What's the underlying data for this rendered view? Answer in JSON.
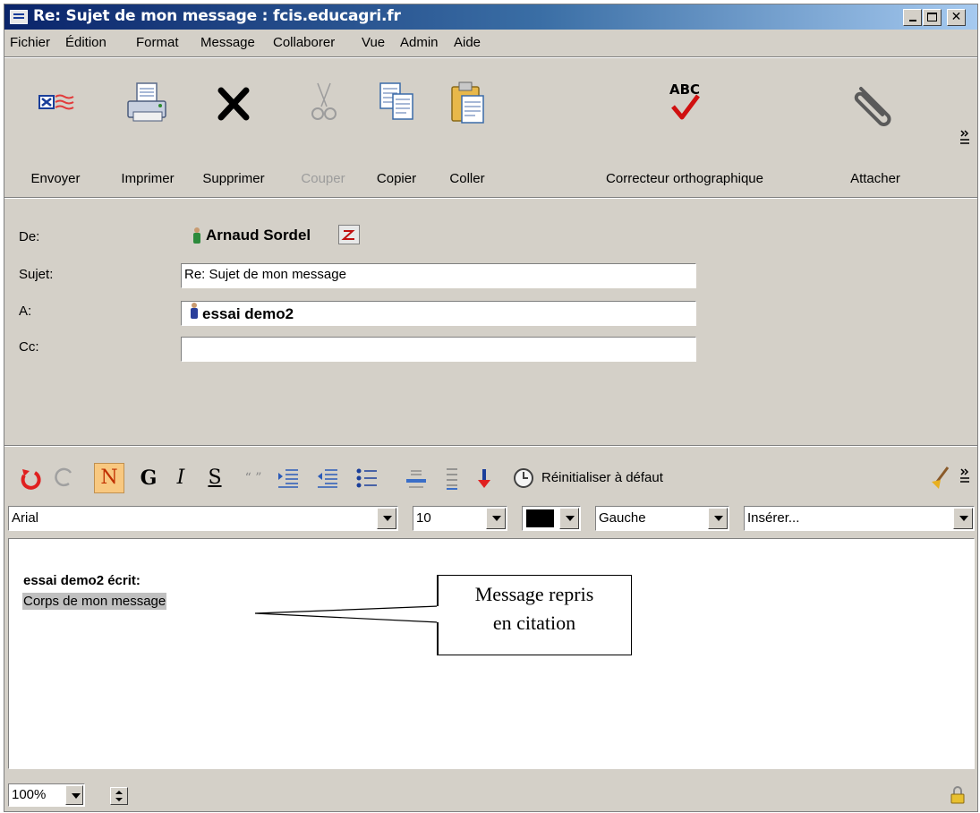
{
  "window": {
    "title": "Re: Sujet de mon message : fcis.educagri.fr"
  },
  "menu": [
    "Fichier",
    "Édition",
    "Format",
    "Message",
    "Collaborer",
    "Vue",
    "Admin",
    "Aide"
  ],
  "toolbar": {
    "send": "Envoyer",
    "print": "Imprimer",
    "delete": "Supprimer",
    "cut": "Couper",
    "copy": "Copier",
    "paste": "Coller",
    "spell": "Correcteur orthographique",
    "spell_icon_text": "ABC",
    "attach": "Attacher"
  },
  "headers": {
    "from_label": "De:",
    "from_value": "Arnaud Sordel",
    "subject_label": "Sujet:",
    "subject_value": "Re: Sujet de mon message",
    "to_label": "A:",
    "to_value": "essai demo2",
    "cc_label": "Cc:",
    "cc_value": ""
  },
  "format": {
    "bold": "N",
    "italic": "G",
    "italic2": "I",
    "underline": "S",
    "quote": "“ ”",
    "reset": "Réinitialiser à défaut",
    "font": "Arial",
    "size": "10",
    "align": "Gauche",
    "insert": "Insérer..."
  },
  "body": {
    "header": "essai demo2 écrit:",
    "quoted": "Corps de mon message"
  },
  "annotation": {
    "line1": "Message repris",
    "line2": "en citation"
  },
  "status": {
    "zoom": "100%"
  },
  "colors": {
    "title_start": "#0a246a",
    "title_end": "#a6caf0",
    "chrome": "#d4d0c8",
    "quote_highlight": "#c0c0c0"
  }
}
